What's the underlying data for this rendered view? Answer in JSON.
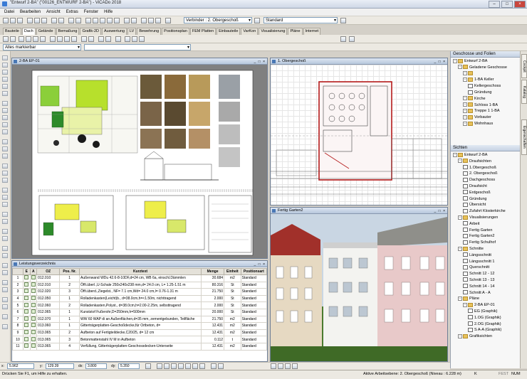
{
  "window": {
    "title": "\"Entwurf 2-BA\" (\"00126_ENTWURF 2-BA\") - ViCADo 2018"
  },
  "menu": [
    "Datei",
    "Bearbeiten",
    "Ansicht",
    "Extras",
    "Fenster",
    "Hilfe"
  ],
  "toolbar": {
    "layer_combo": "Verbinder : 2. Obergeschoß",
    "style_combo": "Standard",
    "filter_combo": "Alles markierbar"
  },
  "tabs": [
    "Bauteile",
    "Dach",
    "Gelände",
    "Bemaßung",
    "Grafik-2D",
    "Auswertung",
    "LV",
    "Bewehrung",
    "Positionsplan",
    "FEM Platten",
    "Einbauteile",
    "VarKon",
    "Visualisierung",
    "Pläne",
    "Internet"
  ],
  "active_tab": "Dach",
  "windows": {
    "plan": {
      "title": "2-BA EP-01"
    },
    "floor": {
      "title": "1. Obergeschoß"
    },
    "render": {
      "title": "Fertig Garten2"
    },
    "list": {
      "title": "Leistungsverzeichnis"
    }
  },
  "list_headers": [
    "",
    "E",
    "A",
    "OZ",
    "Pos. Nr.",
    "Kurztext",
    "Menge",
    "Einheit",
    "Positionsart"
  ],
  "list_rows": [
    [
      "1",
      "012.010",
      "1",
      "Außenwand WDu 42.6-8-10DF,d=24 cm, WB 6a, einschl.Dämmlen",
      "30.684",
      "m2",
      "Standard"
    ],
    [
      "2",
      "012.010",
      "2",
      "Öffi.überl.,U-Schale 250x240x238 mm,d= 24.0 cm, L= 1.25-1.51 m",
      "80.316",
      "St",
      "Standard"
    ],
    [
      "3",
      "012.020",
      "3",
      "Öffi.überd.,Ziegelst., NF= 7.1 cm,Wd= 24.0 cm,l= 0.76-1.31 m",
      "21.750",
      "St",
      "Standard"
    ],
    [
      "4",
      "012.050",
      "1",
      "Rolladenkasten(Leicht)b., d=38.0cm,h=<1.50m, nichttragend",
      "2.000",
      "St",
      "Standard"
    ],
    [
      "5",
      "012.060",
      "2",
      "Rolladenkasten,Polyst., d=38.0cm,h=2.00-2.25m, selbsttragend",
      "2.000",
      "St",
      "Standard"
    ],
    [
      "6",
      "012.065",
      "1",
      "Kunststof Fußerohr,D=250mm,h=500mm",
      "20.000",
      "St",
      "Standard"
    ],
    [
      "7",
      "012.070",
      "1",
      "WW 60 WAP di an Außenflächen,d=35 mm, zementgebunden, Teilfläche",
      "21.750",
      "m2",
      "Standard"
    ],
    [
      "8",
      "013.060",
      "1",
      "Gitterträgerplatten-Geschoßdecke,für Ortbeton, d=",
      "12.431",
      "m2",
      "Standard"
    ],
    [
      "9",
      "013.065",
      "2",
      "Aufbeton auf Fertigteildecke,C20/25, d= 12 cm",
      "12.431",
      "m2",
      "Standard"
    ],
    [
      "10",
      "013.065",
      "3",
      "Betonmattenstahl IV M in Aufbeton",
      "0.112",
      "t",
      "Standard"
    ],
    [
      "11",
      "013.065",
      "4",
      "Verfüllung, Gitterträgerplatten-Geschossdecken-Unterseite",
      "12.431",
      "m2",
      "Standard"
    ]
  ],
  "panels": {
    "top_title": "Geschosse und Folien",
    "bottom_title": "Sichten"
  },
  "tree_top": [
    {
      "label": "Entwurf 2-BA",
      "level": 0,
      "kind": "folder"
    },
    {
      "label": "Geladene Geschosse",
      "level": 1,
      "kind": "folder"
    },
    {
      "label": "",
      "level": 2,
      "kind": "folder"
    },
    {
      "label": "1-BA Keller",
      "level": 2,
      "kind": "folder"
    },
    {
      "label": "Kellergeschoss",
      "level": 3,
      "kind": "doc"
    },
    {
      "label": "Gründung",
      "level": 3,
      "kind": "doc"
    },
    {
      "label": "Kirche",
      "level": 2,
      "kind": "folder"
    },
    {
      "label": "Schloss 1-BA",
      "level": 2,
      "kind": "folder"
    },
    {
      "label": "Treppe 1 1-BA",
      "level": 2,
      "kind": "folder"
    },
    {
      "label": "Vorbauter",
      "level": 2,
      "kind": "folder"
    },
    {
      "label": "Wohnhaus",
      "level": 2,
      "kind": "folder"
    }
  ],
  "tree_bottom": [
    {
      "label": "Entwurf 2-BA",
      "level": 0,
      "kind": "folder"
    },
    {
      "label": "Draufsichten",
      "level": 1,
      "kind": "folder"
    },
    {
      "label": "1.Obergeschoß",
      "level": 2,
      "kind": "doc"
    },
    {
      "label": "2. Obergeschoß",
      "level": 2,
      "kind": "doc"
    },
    {
      "label": "Dachgeschoss",
      "level": 2,
      "kind": "doc"
    },
    {
      "label": "Draufsicht",
      "level": 2,
      "kind": "doc"
    },
    {
      "label": "Erdgeschoß",
      "level": 2,
      "kind": "doc"
    },
    {
      "label": "Gründung",
      "level": 2,
      "kind": "doc"
    },
    {
      "label": "Übersicht",
      "level": 2,
      "kind": "doc"
    },
    {
      "label": "Zufahrt Klosterkirche",
      "level": 2,
      "kind": "doc"
    },
    {
      "label": "Visualisierungen",
      "level": 1,
      "kind": "folder"
    },
    {
      "label": "Arbeit",
      "level": 2,
      "kind": "doc"
    },
    {
      "label": "Fertig Garten",
      "level": 2,
      "kind": "doc"
    },
    {
      "label": "Fertig Garten2",
      "level": 2,
      "kind": "doc"
    },
    {
      "label": "Fertig Schulhof",
      "level": 2,
      "kind": "doc"
    },
    {
      "label": "Schnitte",
      "level": 1,
      "kind": "folder"
    },
    {
      "label": "Längsschnitt",
      "level": 2,
      "kind": "doc"
    },
    {
      "label": "Längsschnitt 1",
      "level": 2,
      "kind": "doc"
    },
    {
      "label": "Querschnitt",
      "level": 2,
      "kind": "doc"
    },
    {
      "label": "Schnitt 12 - 12",
      "level": 2,
      "kind": "doc"
    },
    {
      "label": "Schnitt 13 - 13",
      "level": 2,
      "kind": "doc"
    },
    {
      "label": "Schnitt 14 - 14",
      "level": 2,
      "kind": "doc"
    },
    {
      "label": "Schnitt A - A",
      "level": 2,
      "kind": "doc"
    },
    {
      "label": "Pläne",
      "level": 1,
      "kind": "folder"
    },
    {
      "label": "2-BA EP-01",
      "level": 2,
      "kind": "folder"
    },
    {
      "label": "EG (Graphik)",
      "level": 3,
      "kind": "doc"
    },
    {
      "label": "1.OG (Graphik)",
      "level": 3,
      "kind": "doc"
    },
    {
      "label": "2.OG (Graphik)",
      "level": 3,
      "kind": "doc"
    },
    {
      "label": "S A-A (Graphik)",
      "level": 3,
      "kind": "doc"
    },
    {
      "label": "Grafiksichten",
      "level": 1,
      "kind": "folder"
    }
  ],
  "vtabs": [
    "Cockpit",
    "Katalog",
    "Eigenschaften"
  ],
  "coords": {
    "x": "5.962",
    "y": "129.39",
    "dx": "3.800",
    "dy": "5.350"
  },
  "status": {
    "hint": "Drücken Sie F1, um Hilfe zu erhalten.",
    "active": "Aktive Arbeitsebene: 2. Obergeschoß (Niveau : 6.228 m)",
    "k": "K",
    "fest": "FEST",
    "num": "NUM"
  }
}
